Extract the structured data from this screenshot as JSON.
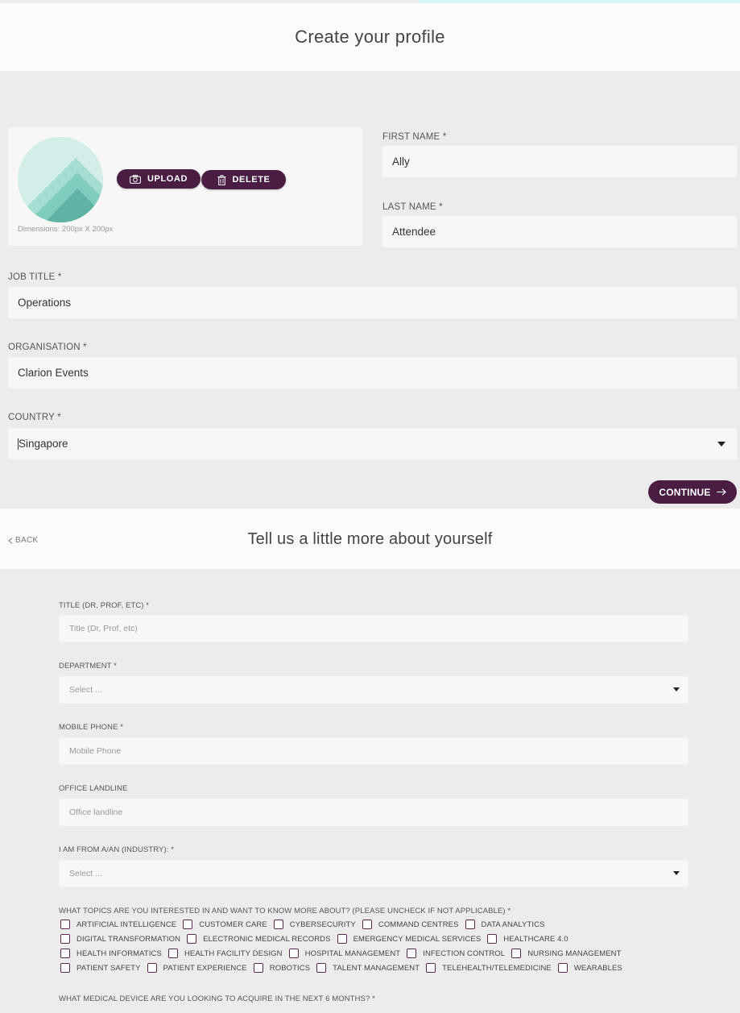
{
  "profile": {
    "title": "Create your profile",
    "photo": {
      "upload_label": "UPLOAD",
      "delete_label": "DELETE",
      "dimensions": "Dimensions: 200px X 200px"
    },
    "first_name": {
      "label": "FIRST NAME *",
      "value": "Ally"
    },
    "last_name": {
      "label": "LAST NAME *",
      "value": "Attendee"
    },
    "job_title": {
      "label": "JOB TITLE *",
      "value": "Operations"
    },
    "organisation": {
      "label": "ORGANISATION *",
      "value": "Clarion Events"
    },
    "country": {
      "label": "COUNTRY *",
      "value": "Singapore"
    },
    "continue_label": "CONTINUE"
  },
  "more": {
    "back_label": "BACK",
    "title": "Tell us a little more about yourself",
    "title_field": {
      "label": "TITLE (DR, PROF, ETC) *",
      "placeholder": "Title (Dr, Prof, etc)"
    },
    "department": {
      "label": "DEPARTMENT *",
      "value": "Select ..."
    },
    "mobile": {
      "label": "MOBILE PHONE *",
      "placeholder": "Mobile Phone"
    },
    "landline": {
      "label": "OFFICE LANDLINE",
      "placeholder": "Office landline"
    },
    "industry": {
      "label": "I AM FROM A/AN (INDUSTRY): *",
      "value": "Select ..."
    },
    "topics": {
      "label": "WHAT TOPICS ARE YOU INTERESTED IN AND WANT TO KNOW MORE ABOUT? (PLEASE UNCHECK IF NOT APPLICABLE) *",
      "rows": [
        [
          "ARTIFICIAL INTELLIGENCE",
          "CUSTOMER CARE",
          "CYBERSECURITY",
          "COMMAND CENTRES",
          "DATA ANALYTICS"
        ],
        [
          "DIGITAL TRANSFORMATION",
          "ELECTRONIC MEDICAL RECORDS",
          "EMERGENCY MEDICAL SERVICES",
          "HEALTHCARE 4.0"
        ],
        [
          "HEALTH INFORMATICS",
          "HEALTH FACILITY DESIGN",
          "HOSPITAL MANAGEMENT",
          "INFECTION CONTROL",
          "NURSING MANAGEMENT"
        ],
        [
          "PATIENT SAFETY",
          "PATIENT EXPERIENCE",
          "ROBOTICS",
          "TALENT MANAGEMENT",
          "TELEHEALTH/TELEMEDICINE",
          "WEARABLES"
        ]
      ]
    },
    "device": {
      "label": "WHAT MEDICAL DEVICE ARE YOU LOOKING TO ACQUIRE IN THE NEXT 6 MONTHS? *"
    }
  }
}
